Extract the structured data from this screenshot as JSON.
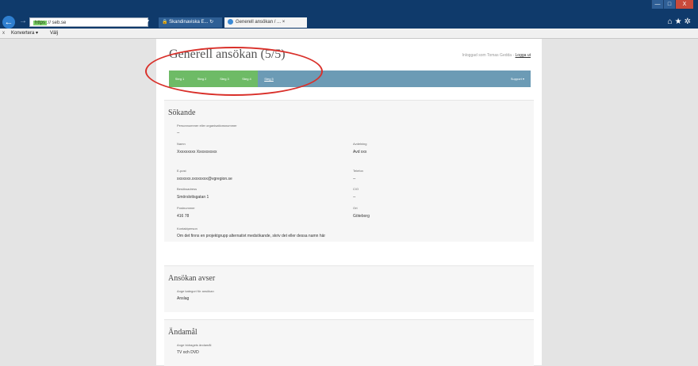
{
  "browser": {
    "back_glyph": "←",
    "forward_glyph": "→",
    "address_https": "https",
    "address_url": "://   seb.se",
    "address_search_glyph": "⌕ ▾",
    "tabs": [
      {
        "label": "🔒 Skandinaviska E... ↻"
      },
      {
        "label": "Generell ansökan / ... ×"
      }
    ],
    "window_controls": [
      "—",
      "□",
      "X"
    ],
    "toolbar_icons": "⌂★✲",
    "command_close": "x",
    "command_konvertera": "Konvertera ▾",
    "command_valj": "Välj"
  },
  "page": {
    "title": "Generell ansökan (5/5)",
    "login_text": "Inloggad som Tomas Gedda -",
    "logout_link": "Logga ut",
    "steps": [
      "Steg 1",
      "Steg 2",
      "Steg 3",
      "Steg 4",
      "Steg 5"
    ],
    "support_label": "Support ▾"
  },
  "sokande": {
    "title": "Sökande",
    "personnummer_label": "Personnummer eller organisationsnummer",
    "personnummer_value": "--",
    "namn_label": "Namn",
    "namn_value": "Xxxxxxxxx Xxxxxxxxxx",
    "avdelning_label": "Avdelning",
    "avdelning_value": "Avd xxx",
    "epost_label": "E-post",
    "epost_value": "xxxxxxx.xxxxxxxx@vgregion.se",
    "telefon_label": "Telefon",
    "telefon_value": "--",
    "besoksadress_label": "Besöksadress",
    "besoksadress_value": "Smörslottsgatan 1",
    "co_label": "C/O",
    "co_value": "--",
    "postnummer_label": "Postnummer",
    "postnummer_value": "416 78",
    "ort_label": "Ort",
    "ort_value": "Göteborg",
    "kontaktperson_label": "Kontaktperson",
    "kontaktperson_value": "Om det finns en projektgrupp alternativt medsökande, skriv det eller dessa namn här"
  },
  "avser": {
    "title": "Ansökan avser",
    "kategori_label": "Ange kategori för ansökan",
    "kategori_value": "Anslag"
  },
  "andamal": {
    "title": "Ändamål",
    "andamal_label": "Ange bidragets ändamål",
    "andamal_value": "TV och DVD"
  },
  "colors": {
    "step_done": "#6ebb66",
    "step_bar": "#6c9bb5",
    "annotation": "#d9302a"
  }
}
